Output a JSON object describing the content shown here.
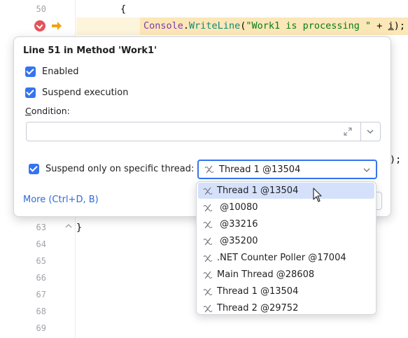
{
  "editor": {
    "line_numbers": [
      "50",
      "63",
      "64",
      "65",
      "66",
      "67",
      "68",
      "69"
    ],
    "line_50_code": "{",
    "line_51": {
      "class": "Console",
      "dot": ".",
      "method": "WriteLine",
      "open": "(",
      "string": "\"Work1 is processing \"",
      "plus": " + ",
      "param": "i",
      "close": ");"
    },
    "line_63_code": "}",
    "right_fragment": ");"
  },
  "popup": {
    "title": "Line 51 in Method 'Work1'",
    "enabled_label": "Enabled",
    "suspend_label": "Suspend execution",
    "condition_label_first": "C",
    "condition_label_rest": "ondition:",
    "condition_value": "",
    "thread_label": "Suspend only on specific thread:",
    "thread_selected": "Thread 1 @13504",
    "more_link": "More (Ctrl+D, B)"
  },
  "dropdown": {
    "options": [
      "Thread 1 @13504",
      " @10080",
      " @33216",
      " @35200",
      ".NET Counter Poller @17004",
      "Main Thread @28608",
      "Thread 1 @13504",
      "Thread 2 @29752"
    ]
  },
  "icons": {
    "breakpoint": "breakpoint-icon",
    "execution_arrow": "execution-arrow-icon",
    "thread": "thread-icon",
    "expand": "expand-icon",
    "chevron": "chevron-down-icon",
    "fold": "fold-icon",
    "cursor": "mouse-cursor-icon"
  },
  "colors": {
    "accent": "#3574f0",
    "breakpoint": "#e3545a",
    "exec_arrow": "#f0a30a",
    "selection": "#d5e1fb"
  }
}
